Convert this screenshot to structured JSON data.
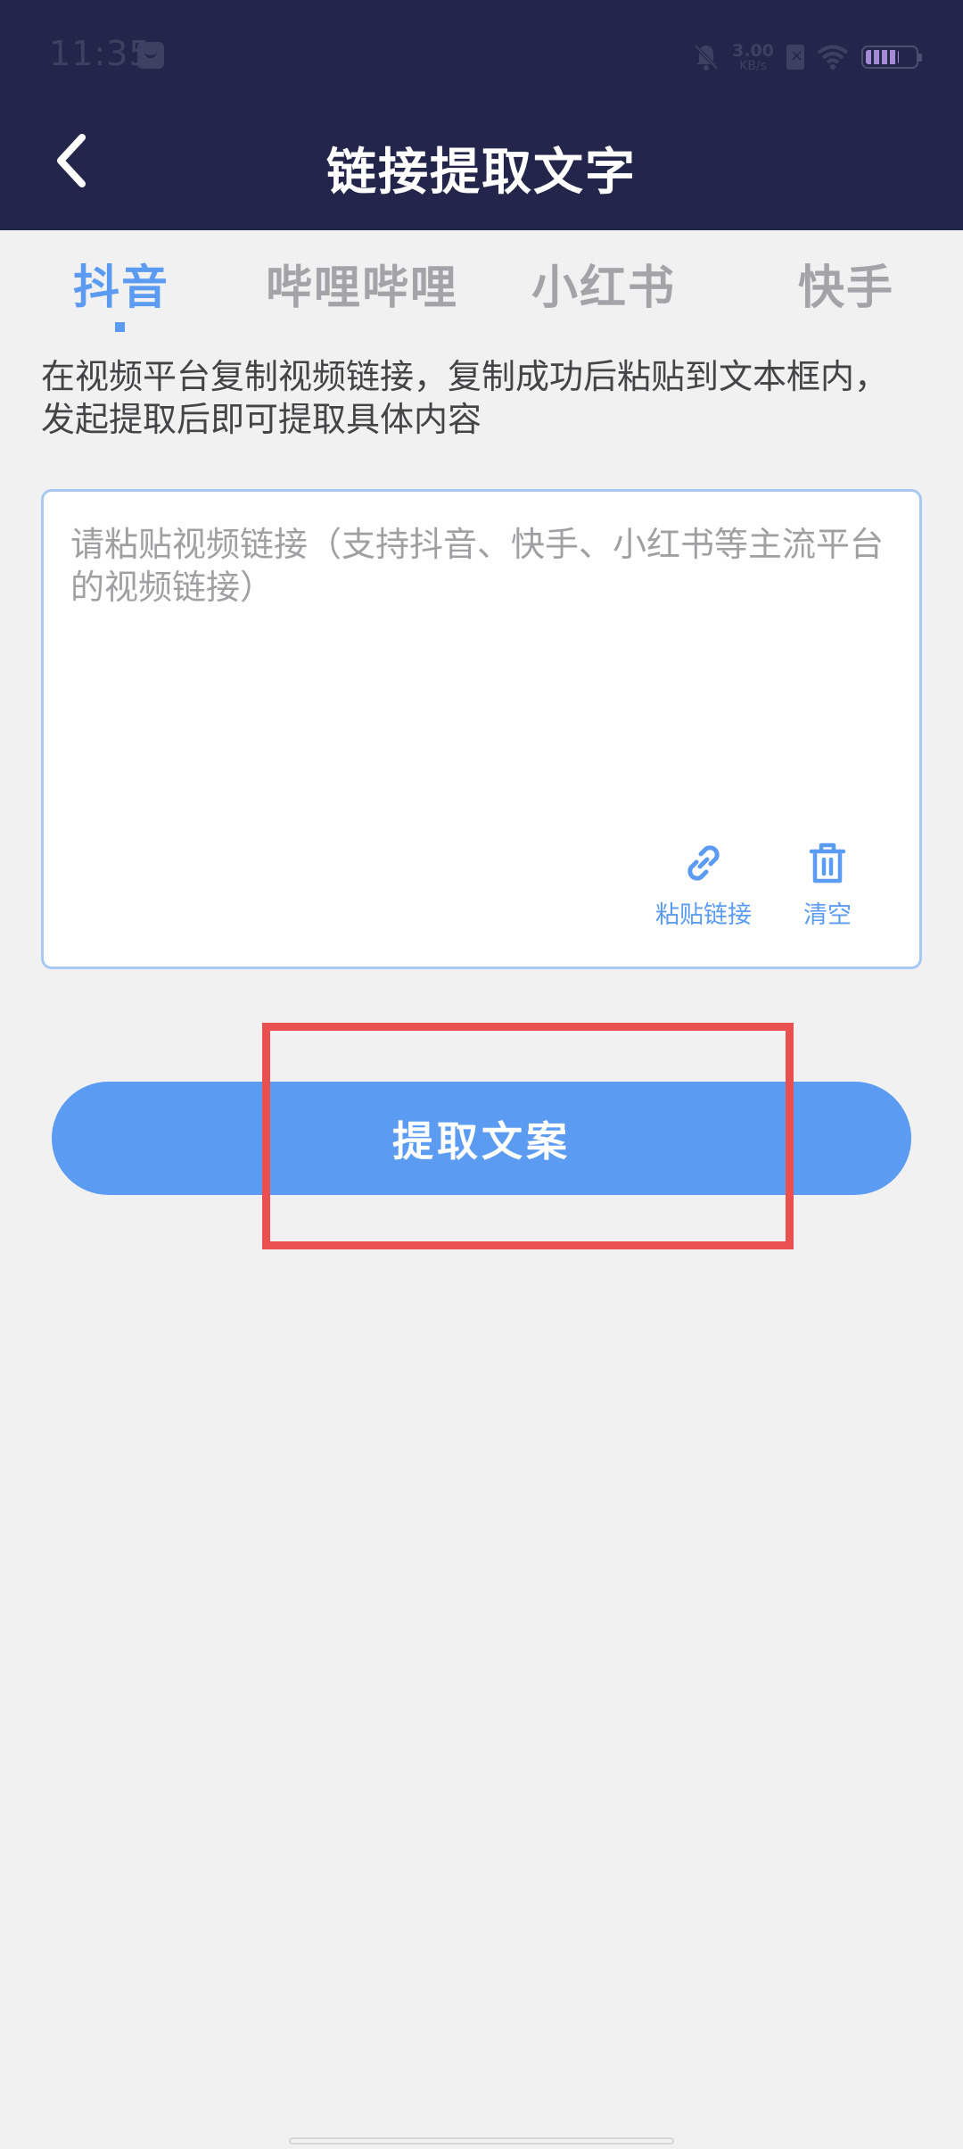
{
  "status_bar": {
    "time": "11:35",
    "net_speed_value": "3.00",
    "net_speed_unit": "KB/s",
    "icons": [
      "app-notification-icon",
      "bell-muted-icon",
      "sim-icon",
      "wifi-icon",
      "battery-icon"
    ]
  },
  "header": {
    "title": "链接提取文字",
    "back_icon": "chevron-left-icon"
  },
  "tabs": [
    {
      "label": "抖音",
      "active": true
    },
    {
      "label": "哔哩哔哩",
      "active": false
    },
    {
      "label": "小红书",
      "active": false
    },
    {
      "label": "快手",
      "active": false
    }
  ],
  "description": {
    "line1": "在视频平台复制视频链接，复制成功后粘贴到文本框内，",
    "line2": "发起提取后即可提取具体内容"
  },
  "input": {
    "value": "",
    "placeholder": "请粘贴视频链接（支持抖音、快手、小红书等主流平台的视频链接）"
  },
  "actions": {
    "paste_label": "粘贴链接",
    "clear_label": "清空"
  },
  "extract_button": {
    "label": "提取文案"
  },
  "colors": {
    "header_bg": "#23264a",
    "accent": "#5b9cf2",
    "highlight": "#e9504f",
    "page_bg": "#f1f1f2"
  }
}
